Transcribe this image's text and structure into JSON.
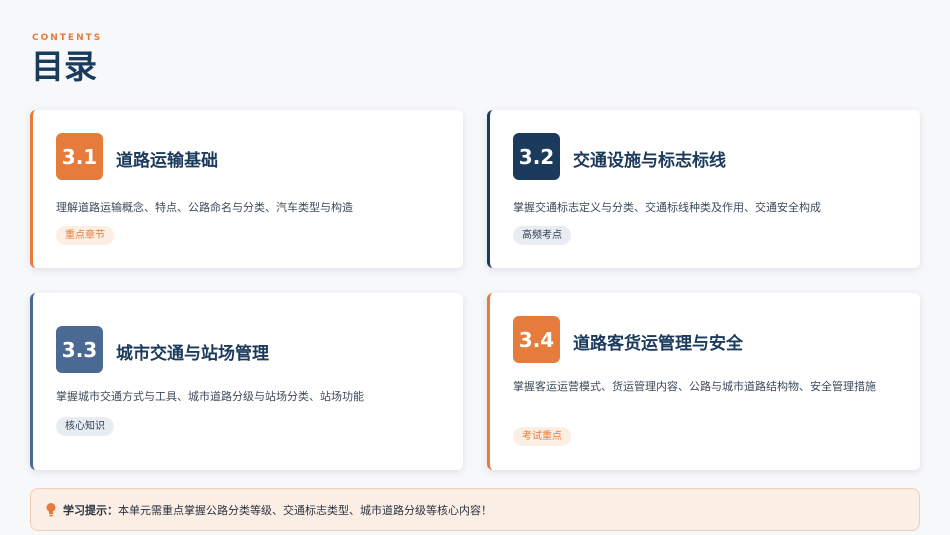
{
  "header": {
    "eyebrow": "CONTENTS",
    "title": "目录"
  },
  "sections": [
    {
      "number": "3.1",
      "title": "道路运输基础",
      "description": "理解道路运输概念、特点、公路命名与分类、汽车类型与构造",
      "tag": "重点章节",
      "accent": "#e57c3b"
    },
    {
      "number": "3.2",
      "title": "交通设施与标志标线",
      "description": "掌握交通标志定义与分类、交通标线种类及作用、交通安全构成",
      "tag": "高频考点",
      "accent": "#1b3a5c"
    },
    {
      "number": "3.3",
      "title": "城市交通与站场管理",
      "description": "掌握城市交通方式与工具、城市道路分级与站场分类、站场功能",
      "tag": "核心知识",
      "accent": "#4a6a93"
    },
    {
      "number": "3.4",
      "title": "道路客货运管理与安全",
      "description": "掌握客运运营模式、货运管理内容、公路与城市道路结构物、安全管理措施",
      "tag": "考试重点",
      "accent": "#e57c3b"
    }
  ],
  "tip": {
    "icon": "lightbulb-icon",
    "label": "学习提示：",
    "text": "本单元需重点掌握公路分类等级、交通标志类型、城市道路分级等核心内容！"
  },
  "colors": {
    "orange": "#e57c3b",
    "navy": "#1b3a5c",
    "slate": "#4a6a93"
  }
}
